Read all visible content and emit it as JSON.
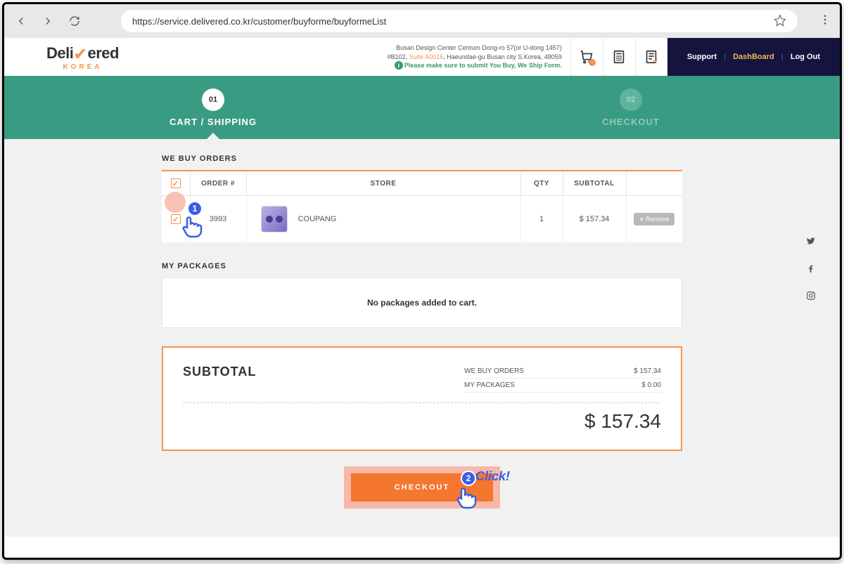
{
  "browser": {
    "url": "https://service.delivered.co.kr/customer/buyforme/buyformeList"
  },
  "logo": {
    "main_left": "Deli",
    "main_right": "ered",
    "sub": "KOREA"
  },
  "header_info": {
    "line1": "Busan Design Center Centum Dong-ro 57(or U-dong 1457)",
    "line2_a": "#B102, ",
    "line2_suite": "Suite A0016",
    "line2_b": ", Haeundae-gu Busan city S.Korea, 48059",
    "notice": "Please make sure to submit You Buy, We Ship Form."
  },
  "top_nav": {
    "support": "Support",
    "dashboard": "DashBoard",
    "logout": "Log Out"
  },
  "steps": {
    "s1_num": "01",
    "s1_label": "CART / SHIPPING",
    "s2_num": "02",
    "s2_label": "CHECKOUT"
  },
  "sections": {
    "we_buy": "WE BUY ORDERS",
    "my_packages": "MY PACKAGES",
    "no_packages": "No packages added to cart."
  },
  "table": {
    "h_order": "ORDER #",
    "h_store": "STORE",
    "h_qty": "QTY",
    "h_subtotal": "SUBTOTAL",
    "rows": [
      {
        "order": "3993",
        "store": "COUPANG",
        "qty": "1",
        "subtotal": "$ 157.34"
      }
    ],
    "remove": "Remove"
  },
  "subtotal": {
    "label": "SUBTOTAL",
    "line1_label": "WE BUY ORDERS",
    "line1_val": "$ 157.34",
    "line2_label": "MY PACKAGES",
    "line2_val": "$ 0.00",
    "grand": "$ 157.34"
  },
  "checkout": {
    "label": "CHECKOUT"
  },
  "annotations": {
    "m1": "1",
    "m2": "2",
    "click": "Click!"
  }
}
